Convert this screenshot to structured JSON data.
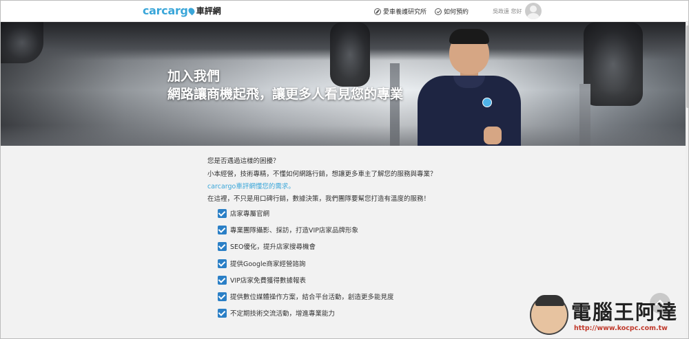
{
  "header": {
    "logo_main": "carcarg",
    "logo_sub": "車評網",
    "nav": [
      {
        "label": "愛車養護研究所",
        "icon": "pen-circle-icon"
      },
      {
        "label": "如何預約",
        "icon": "check-circle-icon"
      }
    ],
    "greeting": "吳政遠 您好"
  },
  "hero": {
    "line1": "加入我們",
    "line2": "網路讓商機起飛，讓更多人看見您的專業"
  },
  "intro": {
    "question": "您是否遇過這樣的困擾？",
    "line1": "小本經營，技術專精，不懂如何網路行銷，想讓更多車主了解您的服務與專業？",
    "line2": "carcargo車評網懂您的需求。",
    "line3": "在這裡，不只是用口碑行銷，數據決策，我們團隊要幫您打造有溫度的服務！"
  },
  "features": [
    {
      "label": "店家專屬官網",
      "checked": true
    },
    {
      "label": "專業團隊攝影、採訪，打造VIP店家品牌形象",
      "checked": true
    },
    {
      "label": "SEO優化，提升店家搜尋機會",
      "checked": true
    },
    {
      "label": "提供Google商家經營諮詢",
      "checked": true
    },
    {
      "label": "VIP店家免費獲得數據報表",
      "checked": true
    },
    {
      "label": "提供數位媒體操作方案，結合平台活動，創造更多能見度",
      "checked": true
    },
    {
      "label": "不定期技術交流活動，增進專業能力",
      "checked": true
    }
  ],
  "watermark": {
    "title": "電腦王阿達",
    "url": "http://www.kocpc.com.tw"
  },
  "colors": {
    "brand": "#3aa6d9",
    "checkbox": "#2a7fc6"
  }
}
